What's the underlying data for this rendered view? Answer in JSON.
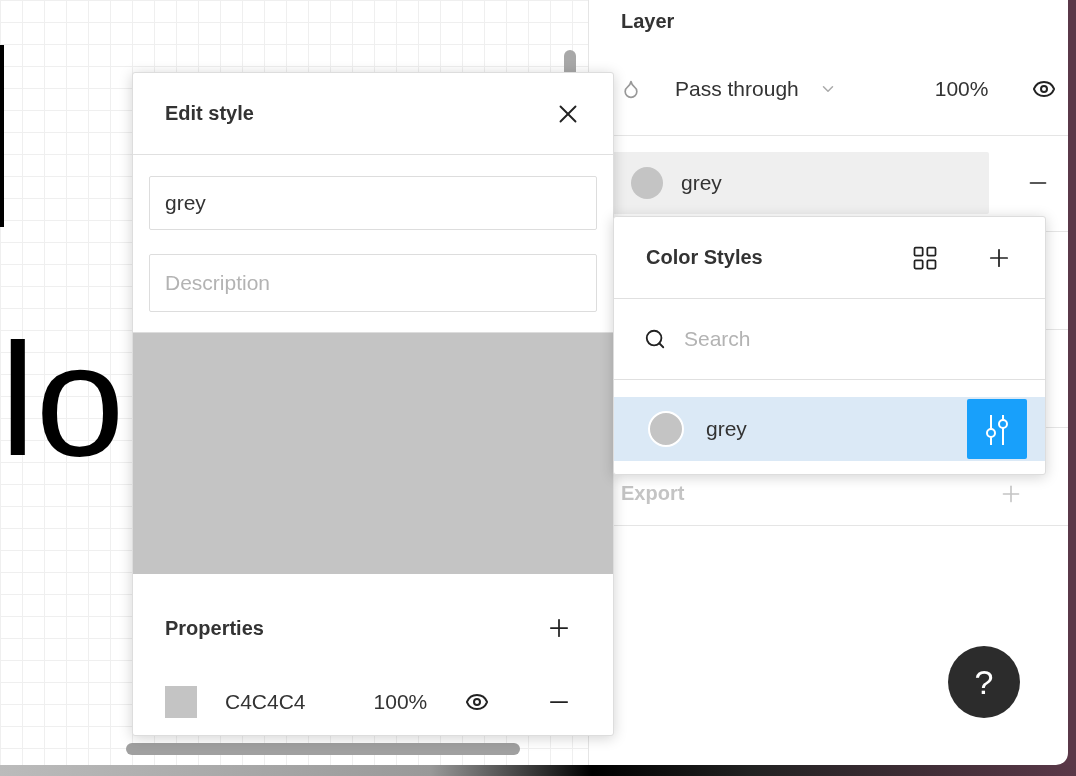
{
  "canvas": {
    "text": "lo"
  },
  "layer_panel": {
    "title": "Layer",
    "blend_mode": "Pass through",
    "opacity": "100%",
    "visible": true
  },
  "fill": {
    "style_name": "grey",
    "color": "#c4c4c4"
  },
  "export": {
    "title": "Export"
  },
  "edit_style": {
    "title": "Edit style",
    "name": "grey",
    "description": {
      "placeholder": "Description"
    },
    "properties_title": "Properties",
    "properties": [
      {
        "color": "#c4c4c4",
        "hex": "C4C4C4",
        "opacity": "100%",
        "visible": true
      }
    ]
  },
  "color_styles": {
    "title": "Color Styles",
    "search": {
      "placeholder": "Search"
    },
    "items": [
      {
        "name": "grey",
        "color": "#c4c4c4",
        "selected": true
      }
    ]
  },
  "help": {
    "label": "?"
  }
}
